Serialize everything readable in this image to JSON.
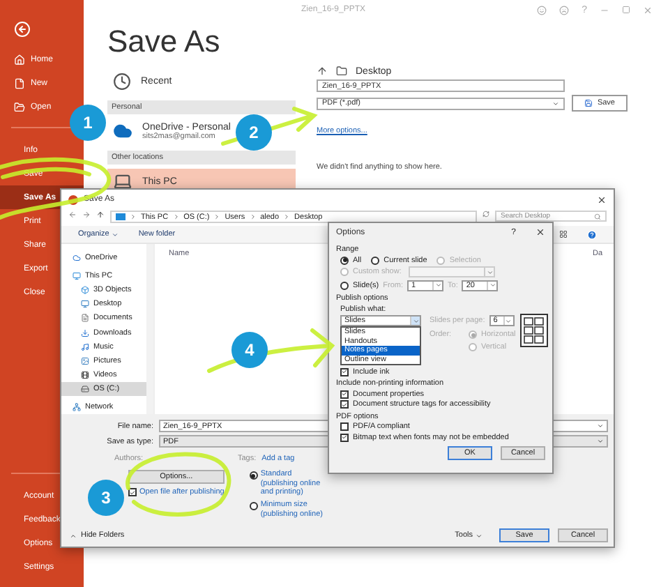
{
  "document_title": "Zien_16-9_PPTX",
  "window_controls": {
    "help": "?"
  },
  "sidebar": {
    "items": [
      {
        "label": "Home",
        "kind": "home",
        "selected": false
      },
      {
        "label": "New",
        "kind": "file",
        "selected": false
      },
      {
        "label": "Open",
        "kind": "folder",
        "selected": false
      },
      {
        "label": "Info",
        "selected": false
      },
      {
        "label": "Save",
        "selected": false
      },
      {
        "label": "Save As",
        "selected": true
      },
      {
        "label": "Print",
        "selected": false
      },
      {
        "label": "Share",
        "selected": false
      },
      {
        "label": "Export",
        "selected": false
      },
      {
        "label": "Close",
        "selected": false
      }
    ],
    "footer_items": [
      {
        "label": "Account",
        "selected": false
      },
      {
        "label": "Feedback",
        "selected": false
      },
      {
        "label": "Options",
        "selected": false
      },
      {
        "label": "Settings",
        "selected": false
      }
    ]
  },
  "backstage": {
    "heading": "Save As",
    "recent": "Recent",
    "groups": [
      {
        "header": "Personal",
        "locations": [
          {
            "name": "OneDrive - Personal",
            "detail": "sits2mas@gmail.com",
            "kind": "cloud",
            "selected": false
          }
        ]
      },
      {
        "header": "Other locations",
        "locations": [
          {
            "name": "This PC",
            "kind": "pc",
            "selected": true
          }
        ]
      }
    ]
  },
  "file_panel": {
    "folder": "Desktop",
    "file_name": "Zien_16-9_PPTX",
    "file_type": "PDF (*.pdf)",
    "save": "Save",
    "more_options": "More options...",
    "empty_message": "We didn't find anything to show here."
  },
  "save_dialog": {
    "title": "Save As",
    "path": [
      "This PC",
      "OS (C:)",
      "Users",
      "aledo",
      "Desktop"
    ],
    "search_placeholder": "Search Desktop",
    "organize": "Organize",
    "new_folder": "New folder",
    "nav": [
      {
        "label": "OneDrive",
        "kind": "cloud",
        "selected": false
      },
      {
        "label": "This PC",
        "kind": "pc",
        "selected": false,
        "children": [
          {
            "label": "3D Objects",
            "kind": "cube",
            "selected": false
          },
          {
            "label": "Desktop",
            "kind": "desktop",
            "selected": false
          },
          {
            "label": "Documents",
            "kind": "doc",
            "selected": false
          },
          {
            "label": "Downloads",
            "kind": "download",
            "selected": false
          },
          {
            "label": "Music",
            "kind": "music",
            "selected": false
          },
          {
            "label": "Pictures",
            "kind": "image",
            "selected": false
          },
          {
            "label": "Videos",
            "kind": "film",
            "selected": false
          },
          {
            "label": "OS (C:)",
            "kind": "drive",
            "selected": true
          }
        ]
      },
      {
        "label": "Network",
        "kind": "network",
        "selected": false
      }
    ],
    "columns": [
      "Name",
      "Da"
    ],
    "file_name_label": "File name:",
    "file_name": "Zien_16-9_PPTX",
    "type_label": "Save as type:",
    "type": "PDF",
    "authors_label": "Authors:",
    "tags_label": "Tags:",
    "tags_link": "Add a tag",
    "options_button": "Options...",
    "open_after": {
      "label": "Open file after publishing",
      "checked": true
    },
    "optimize": [
      {
        "label": "Standard (publishing online and printing)",
        "selected": true
      },
      {
        "label": "Minimum size (publishing online)",
        "selected": false
      }
    ],
    "hide_folders": "Hide Folders",
    "tools": "Tools",
    "buttons": [
      {
        "label": "Save",
        "default": true
      },
      {
        "label": "Cancel",
        "default": false
      }
    ]
  },
  "options_dialog": {
    "title": "Options",
    "help": "?",
    "range_heading": "Range",
    "range_choices": [
      {
        "label": "All",
        "selected": true,
        "disabled": false
      },
      {
        "label": "Current slide",
        "selected": false,
        "disabled": false
      },
      {
        "label": "Selection",
        "selected": false,
        "disabled": true
      }
    ],
    "custom_show": {
      "label": "Custom show:",
      "selected": false,
      "disabled": true
    },
    "slides": {
      "label": "Slide(s)",
      "selected": false,
      "from_label": "From:",
      "from": "1",
      "to_label": "To:",
      "to": "20"
    },
    "publish_heading": "Publish options",
    "what_label": "Publish what:",
    "what_value": "Slides",
    "what_list": [
      {
        "label": "Slides",
        "selected": false
      },
      {
        "label": "Handouts",
        "selected": false
      },
      {
        "label": "Notes pages",
        "selected": true
      },
      {
        "label": "Outline view",
        "selected": false
      }
    ],
    "per_page_label": "Slides per page:",
    "per_page": "6",
    "order_label": "Order:",
    "orders": [
      {
        "label": "Horizontal",
        "selected": true,
        "disabled": true
      },
      {
        "label": "Vertical",
        "selected": false,
        "disabled": true
      }
    ],
    "include_ink": {
      "label": "Include ink",
      "checked": true
    },
    "non_printing_heading": "Include non-printing information",
    "non_printing": [
      {
        "label": "Document properties",
        "checked": true
      },
      {
        "label": "Document structure tags for accessibility",
        "checked": true
      }
    ],
    "pdf_heading": "PDF options",
    "pdf": [
      {
        "label": "PDF/A compliant",
        "checked": false
      },
      {
        "label": "Bitmap text when fonts may not be embedded",
        "checked": true
      }
    ],
    "buttons": [
      {
        "label": "OK",
        "default": true
      },
      {
        "label": "Cancel",
        "default": false
      }
    ]
  },
  "annotations": [
    {
      "number": "1"
    },
    {
      "number": "2"
    },
    {
      "number": "3"
    },
    {
      "number": "4"
    }
  ]
}
